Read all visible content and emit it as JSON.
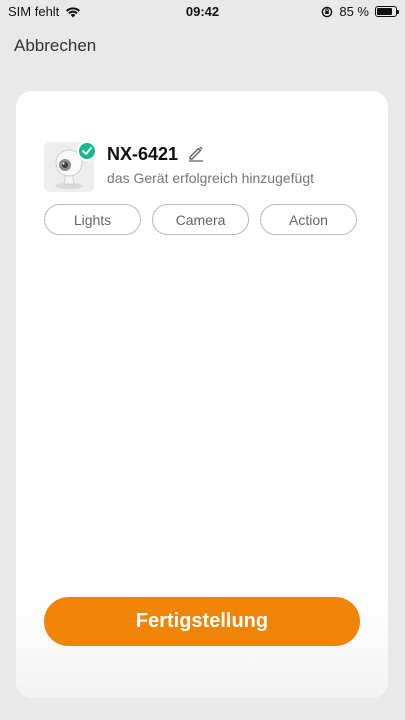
{
  "status_bar": {
    "carrier": "SIM fehlt",
    "time": "09:42",
    "battery_text": "85 %",
    "battery_level": 0.85,
    "icons": [
      "wifi-icon",
      "orientation-lock-icon",
      "battery-icon"
    ]
  },
  "header": {
    "cancel_label": "Abbrechen"
  },
  "device": {
    "name": "NX-6421",
    "status": "das Gerät erfolgreich hinzugefügt",
    "image": "camera-device-thumbnail",
    "badge_icon": "check-icon"
  },
  "chips": [
    {
      "label": "Lights"
    },
    {
      "label": "Camera"
    },
    {
      "label": "Action"
    }
  ],
  "footer": {
    "finish_label": "Fertigstellung"
  },
  "colors": {
    "accent": "#ef8407",
    "success": "#19b98e",
    "background": "#e9e9e9"
  }
}
